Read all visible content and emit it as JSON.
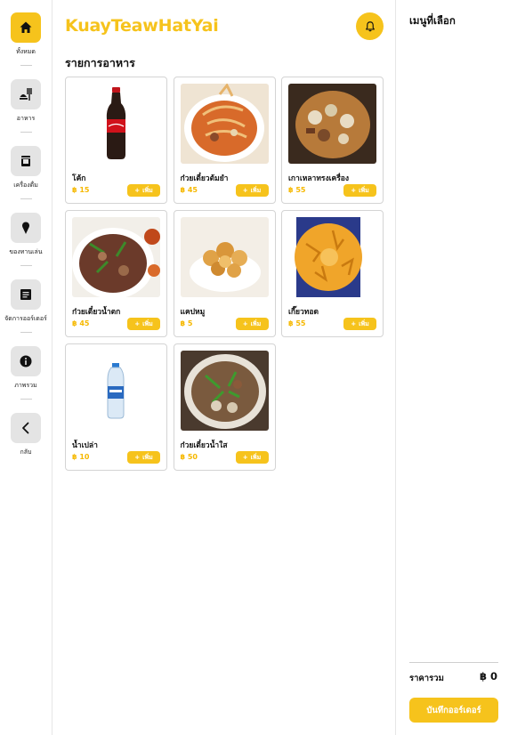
{
  "app": {
    "brand": "KuayTeawHatYai"
  },
  "sidebar": {
    "items": [
      {
        "label": "ทั้งหมด",
        "icon": "home-icon",
        "active": true
      },
      {
        "label": "อาหาร",
        "icon": "food-icon",
        "active": false
      },
      {
        "label": "เครื่องดื่ม",
        "icon": "drink-icon",
        "active": false
      },
      {
        "label": "ของทานเล่น",
        "icon": "ice-cream-icon",
        "active": false
      },
      {
        "label": "จัดการออร์เดอร์",
        "icon": "order-list-icon",
        "active": false
      },
      {
        "label": "ภาพรวม",
        "icon": "info-icon",
        "active": false
      },
      {
        "label": "กลับ",
        "icon": "back-chevron-icon",
        "active": false
      }
    ]
  },
  "header": {
    "notification_icon": "bell-icon"
  },
  "menu": {
    "title": "รายการอาหาร",
    "add_label": "เพิ่ม",
    "items": [
      {
        "name": "โค้ก",
        "price": "฿ 15",
        "image": "coke-bottle"
      },
      {
        "name": "ก๋วยเตี๋ยวต้มยำ",
        "price": "฿ 45",
        "image": "tomyum-noodle"
      },
      {
        "name": "เกาเหลาทรงเครื่อง",
        "price": "฿ 55",
        "image": "kaolao-soup"
      },
      {
        "name": "ก๋วยเตี๋ยวน้ำตก",
        "price": "฿ 45",
        "image": "namtok-noodle"
      },
      {
        "name": "แคปหมู",
        "price": "฿ 5",
        "image": "pork-crackling"
      },
      {
        "name": "เกี๊ยวทอด",
        "price": "฿ 55",
        "image": "fried-wonton"
      },
      {
        "name": "น้ำเปล่า",
        "price": "฿ 10",
        "image": "water-bottle"
      },
      {
        "name": "ก๋วยเตี๋ยวน้ำใส",
        "price": "฿ 50",
        "image": "clear-soup-noodle"
      }
    ]
  },
  "cart": {
    "title": "เมนูที่เลือก",
    "total_label": "ราคารวม",
    "total_value": "฿ 0",
    "save_label": "บันทึกออร์เดอร์"
  },
  "colors": {
    "accent": "#f6c31c",
    "price": "#f6b800",
    "nav_bg": "#e4e4e4"
  }
}
